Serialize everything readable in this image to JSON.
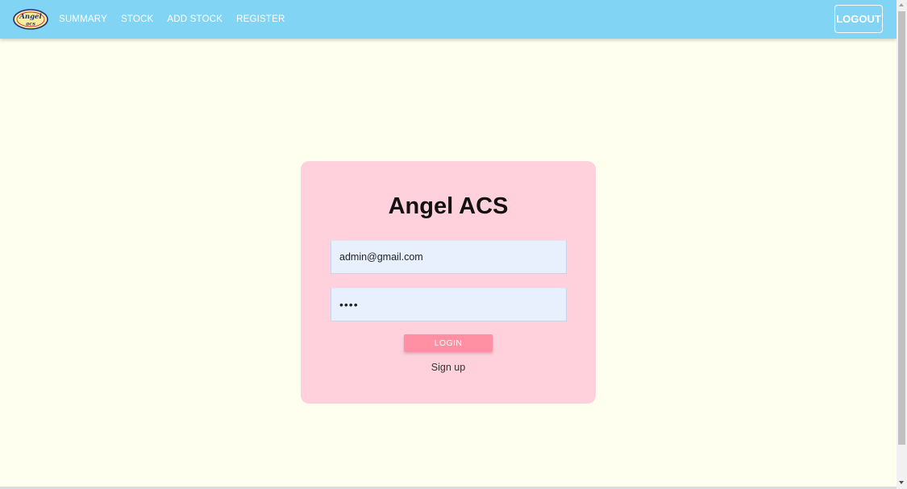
{
  "nav": {
    "logo_text": "Angel ACS",
    "links": [
      "SUMMARY",
      "STOCK",
      "ADD STOCK",
      "REGISTER"
    ],
    "logout_label": "LOGOUT"
  },
  "login": {
    "title": "Angel ACS",
    "email_value": "admin@gmail.com",
    "password_value": "••••",
    "login_label": "LOGIN",
    "signup_label": "Sign up"
  },
  "colors": {
    "navbar": "#81d4f4",
    "background": "#fffff0",
    "card": "#ffd1dc",
    "input": "#e8f0fe",
    "login_button": "#ff8fa3"
  }
}
